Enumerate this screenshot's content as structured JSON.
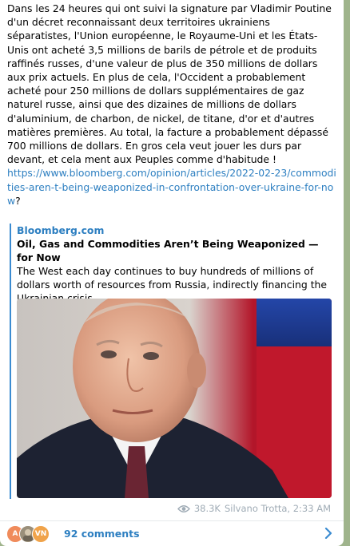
{
  "message": {
    "body": "Dans les 24 heures qui ont suivi la signature par Vladimir Poutine d'un décret reconnaissant deux territoires ukrainiens séparatistes, l'Union européenne, le Royaume-Uni et les États-Unis ont acheté 3,5 millions de barils de pétrole et de produits raffinés russes, d'une valeur de plus de 350 millions de dollars aux prix actuels. En plus de cela, l'Occident a probablement acheté pour 250 millions de dollars supplémentaires de gaz naturel russe, ainsi que des dizaines de millions de dollars d'aluminium, de charbon, de nickel, de titane, d'or et d'autres matières premières. Au total, la facture a probablement dépassé 700 millions de dollars. En gros cela veut jouer les durs par devant, et cela ment aux Peuples comme d'habitude !\n",
    "link": "https://www.bloomberg.com/opinion/articles/2022-02-23/commodities-aren-t-being-weaponized-in-confrontation-over-ukraine-for-now",
    "link_suffix": "?"
  },
  "preview": {
    "site": "Bloomberg.com",
    "title": "Oil, Gas and Commodities Aren’t Being Weaponized — for Now",
    "description": "The West each day continues to buy hundreds of millions of dollars worth of resources from Russia, indirectly financing the Ukrainian crisis."
  },
  "meta": {
    "views": "38.3K",
    "author_time": "Silvano Trotta, 2:33 AM"
  },
  "comments": {
    "label": "92 comments",
    "avatars": [
      "A",
      "",
      "VN"
    ]
  },
  "colors": {
    "link": "#2d7fc1",
    "accent_bar": "#3a8bd1",
    "meta": "#a0acb6",
    "background": "#9fb48c"
  }
}
